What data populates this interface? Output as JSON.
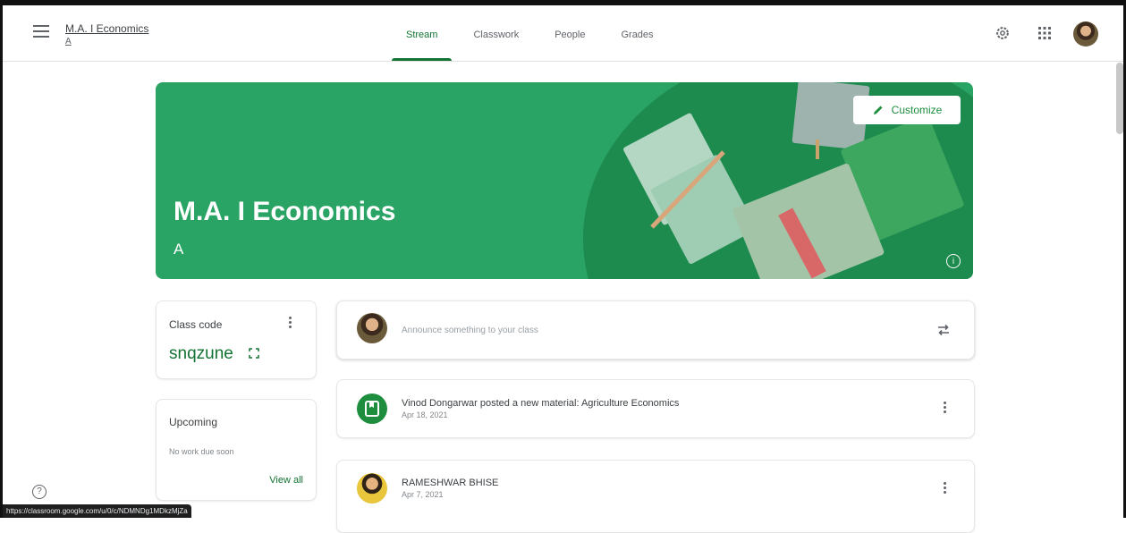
{
  "header": {
    "class_title": "M.A. I Economics",
    "class_section": "A",
    "tabs": [
      {
        "label": "Stream",
        "active": true
      },
      {
        "label": "Classwork",
        "active": false
      },
      {
        "label": "People",
        "active": false
      },
      {
        "label": "Grades",
        "active": false
      }
    ],
    "icons": [
      "menu-icon",
      "settings-icon",
      "apps-grid-icon",
      "account-avatar"
    ]
  },
  "banner": {
    "title": "M.A. I Economics",
    "section": "A",
    "customize_label": "Customize",
    "color": "#2aa464"
  },
  "class_code": {
    "label": "Class code",
    "code": "snqzune"
  },
  "upcoming": {
    "title": "Upcoming",
    "empty_text": "No work due soon",
    "view_all_label": "View all"
  },
  "announce": {
    "placeholder": "Announce something to your class"
  },
  "posts": [
    {
      "title": "Vinod Dongarwar posted a new material: Agriculture Economics",
      "date": "Apr 18, 2021"
    },
    {
      "title": "RAMESHWAR BHISE",
      "date": "Apr 7, 2021"
    }
  ],
  "status_bar": {
    "url": "https://classroom.google.com/u/0/c/NDMNDg1MDkzMjZa"
  },
  "colors": {
    "accent": "#137333",
    "banner_dark": "#1d8a4e"
  }
}
